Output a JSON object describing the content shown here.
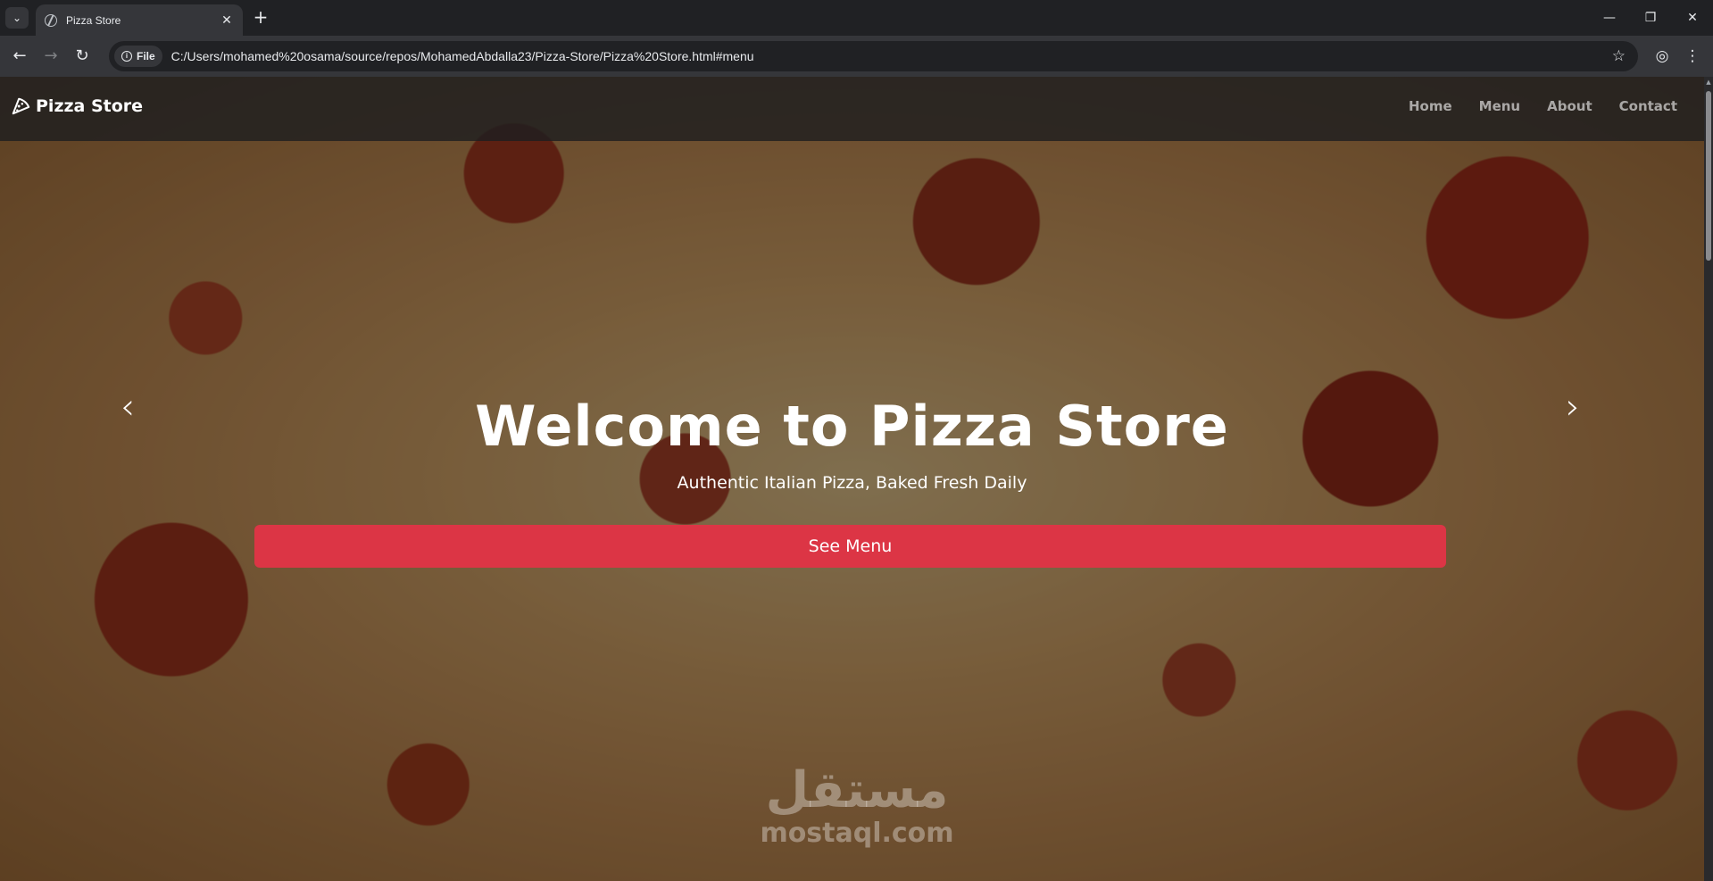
{
  "browser": {
    "tab_title": "Pizza Store",
    "url_chip": "File",
    "url": "C:/Users/mohamed%20osama/source/repos/MohamedAbdalla23/Pizza-Store/Pizza%20Store.html#menu"
  },
  "site": {
    "brand": "Pizza Store",
    "nav": [
      "Home",
      "Menu",
      "About",
      "Contact"
    ]
  },
  "hero": {
    "title": "Welcome to Pizza Store",
    "subtitle": "Authentic Italian Pizza, Baked Fresh Daily",
    "button": "See Menu"
  },
  "watermark": {
    "logo": "مستقل",
    "domain": "mostaql.com"
  },
  "colors": {
    "accent": "#dc3545",
    "nav_bg": "#1e1e20"
  },
  "icons": {
    "tab_search": "chevron-down-icon",
    "back": "arrow-left-icon",
    "forward": "arrow-right-icon",
    "reload": "reload-icon",
    "bookmark": "star-icon",
    "profile": "account-icon",
    "menu": "kebab-menu-icon",
    "brand": "pizza-slice-icon",
    "prev": "chevron-left-icon",
    "next": "chevron-right-icon"
  }
}
